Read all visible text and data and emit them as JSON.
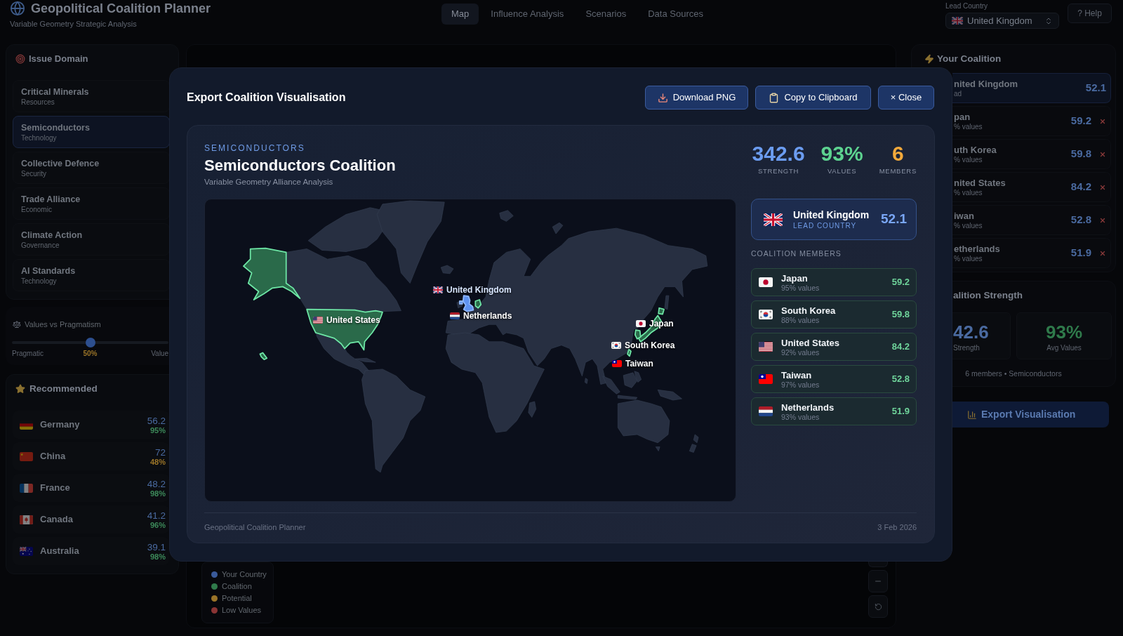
{
  "header": {
    "title": "Geopolitical Coalition Planner",
    "subtitle": "Variable Geometry Strategic Analysis",
    "nav": [
      {
        "label": "Map",
        "selected": true
      },
      {
        "label": "Influence Analysis",
        "selected": false
      },
      {
        "label": "Scenarios",
        "selected": false
      },
      {
        "label": "Data Sources",
        "selected": false
      }
    ],
    "lead_country": {
      "label": "Lead Country",
      "value": "United Kingdom"
    },
    "help_button": "? Help"
  },
  "left_sidebar": {
    "issue_domain": {
      "title": "Issue Domain",
      "items": [
        {
          "name": "Critical Minerals",
          "category": "Resources",
          "selected": false
        },
        {
          "name": "Semiconductors",
          "category": "Technology",
          "selected": true
        },
        {
          "name": "Collective Defence",
          "category": "Security",
          "selected": false
        },
        {
          "name": "Trade Alliance",
          "category": "Economic",
          "selected": false
        },
        {
          "name": "Climate Action",
          "category": "Governance",
          "selected": false
        },
        {
          "name": "AI Standards",
          "category": "Technology",
          "selected": false
        }
      ]
    },
    "values_slider": {
      "title": "Values vs Pragmatism",
      "level": 0.5,
      "min_label": "Pragmatic",
      "reading": "50%",
      "max_label": "Value"
    },
    "recommended": {
      "title": "Recommended",
      "items": [
        {
          "name": "Germany",
          "score": "56.2",
          "values": "95%",
          "color": "#3d8a5a"
        },
        {
          "name": "China",
          "score": "72",
          "values": "48%",
          "color": "#9a7428"
        },
        {
          "name": "France",
          "score": "48.2",
          "values": "98%",
          "color": "#3d8a5a"
        },
        {
          "name": "Canada",
          "score": "41.2",
          "values": "96%",
          "color": "#3d8a5a"
        },
        {
          "name": "Australia",
          "score": "39.1",
          "values": "98%",
          "color": "#3d8a5a"
        }
      ]
    }
  },
  "map_panel": {
    "legend": [
      {
        "label": "Your Country",
        "color": "#3a5a9a"
      },
      {
        "label": "Coalition",
        "color": "#2f7a4b"
      },
      {
        "label": "Potential",
        "color": "#9a7428"
      },
      {
        "label": "Low Values",
        "color": "#8a3434"
      }
    ]
  },
  "right_sidebar": {
    "coalition": {
      "title": "Your Coalition",
      "members": [
        {
          "name": "nited Kingdom",
          "detail": "ad",
          "score": "52.1",
          "kind": "lead"
        },
        {
          "name": "pan",
          "detail": "% values",
          "score": "59.2",
          "kind": "member"
        },
        {
          "name": "uth Korea",
          "detail": "% values",
          "score": "59.8",
          "kind": "member"
        },
        {
          "name": "nited States",
          "detail": "% values",
          "score": "84.2",
          "kind": "member"
        },
        {
          "name": "iwan",
          "detail": "% values",
          "score": "52.8",
          "kind": "member"
        },
        {
          "name": "etherlands",
          "detail": "% values",
          "score": "51.9",
          "kind": "member"
        }
      ]
    },
    "strength": {
      "title": "alition Strength",
      "stats": [
        {
          "value": "42.6",
          "label": "Strength",
          "color": "#4a6aa0"
        },
        {
          "value": "93%",
          "label": "Avg Values",
          "color": "#2f7a4b"
        }
      ],
      "summary": "6 members • Semiconductors"
    },
    "export_button": "Export Visualisation"
  },
  "dialog": {
    "title": "Export Coalition Visualisation",
    "buttons": [
      {
        "label": "Download PNG",
        "kind": "download"
      },
      {
        "label": "Copy to Clipboard",
        "kind": "copy"
      },
      {
        "label": "× Close",
        "kind": "close"
      }
    ],
    "card": {
      "eyebrow": "SEMICONDUCTORS",
      "title": "Semiconductors Coalition",
      "subtitle": "Variable Geometry Alliance Analysis",
      "stats": [
        {
          "value": "342.6",
          "label": "STRENGTH",
          "color": "#6b9cf0"
        },
        {
          "value": "93%",
          "label": "VALUES",
          "color": "#5dd390"
        },
        {
          "value": "6",
          "label": "MEMBERS",
          "color": "#f2a93b"
        }
      ],
      "map": {
        "countries": [
          {
            "name": "United Kingdom",
            "kind": "lead"
          },
          {
            "name": "Netherlands",
            "kind": "member"
          },
          {
            "name": "United States",
            "kind": "member"
          },
          {
            "name": "Japan",
            "kind": "member"
          },
          {
            "name": "South Korea",
            "kind": "member"
          },
          {
            "name": "Taiwan",
            "kind": "member"
          }
        ]
      },
      "lead": {
        "name": "United Kingdom",
        "caption": "LEAD COUNTRY",
        "score": "52.1"
      },
      "members_title": "COALITION MEMBERS",
      "members": [
        {
          "name": "Japan",
          "values": "95% values",
          "score": "59.2"
        },
        {
          "name": "South Korea",
          "values": "88% values",
          "score": "59.8"
        },
        {
          "name": "United States",
          "values": "92% values",
          "score": "84.2"
        },
        {
          "name": "Taiwan",
          "values": "97% values",
          "score": "52.8"
        },
        {
          "name": "Netherlands",
          "values": "93% values",
          "score": "51.9"
        }
      ],
      "footer": {
        "left": "Geopolitical Coalition Planner",
        "right": "3 Feb 2026"
      }
    }
  }
}
